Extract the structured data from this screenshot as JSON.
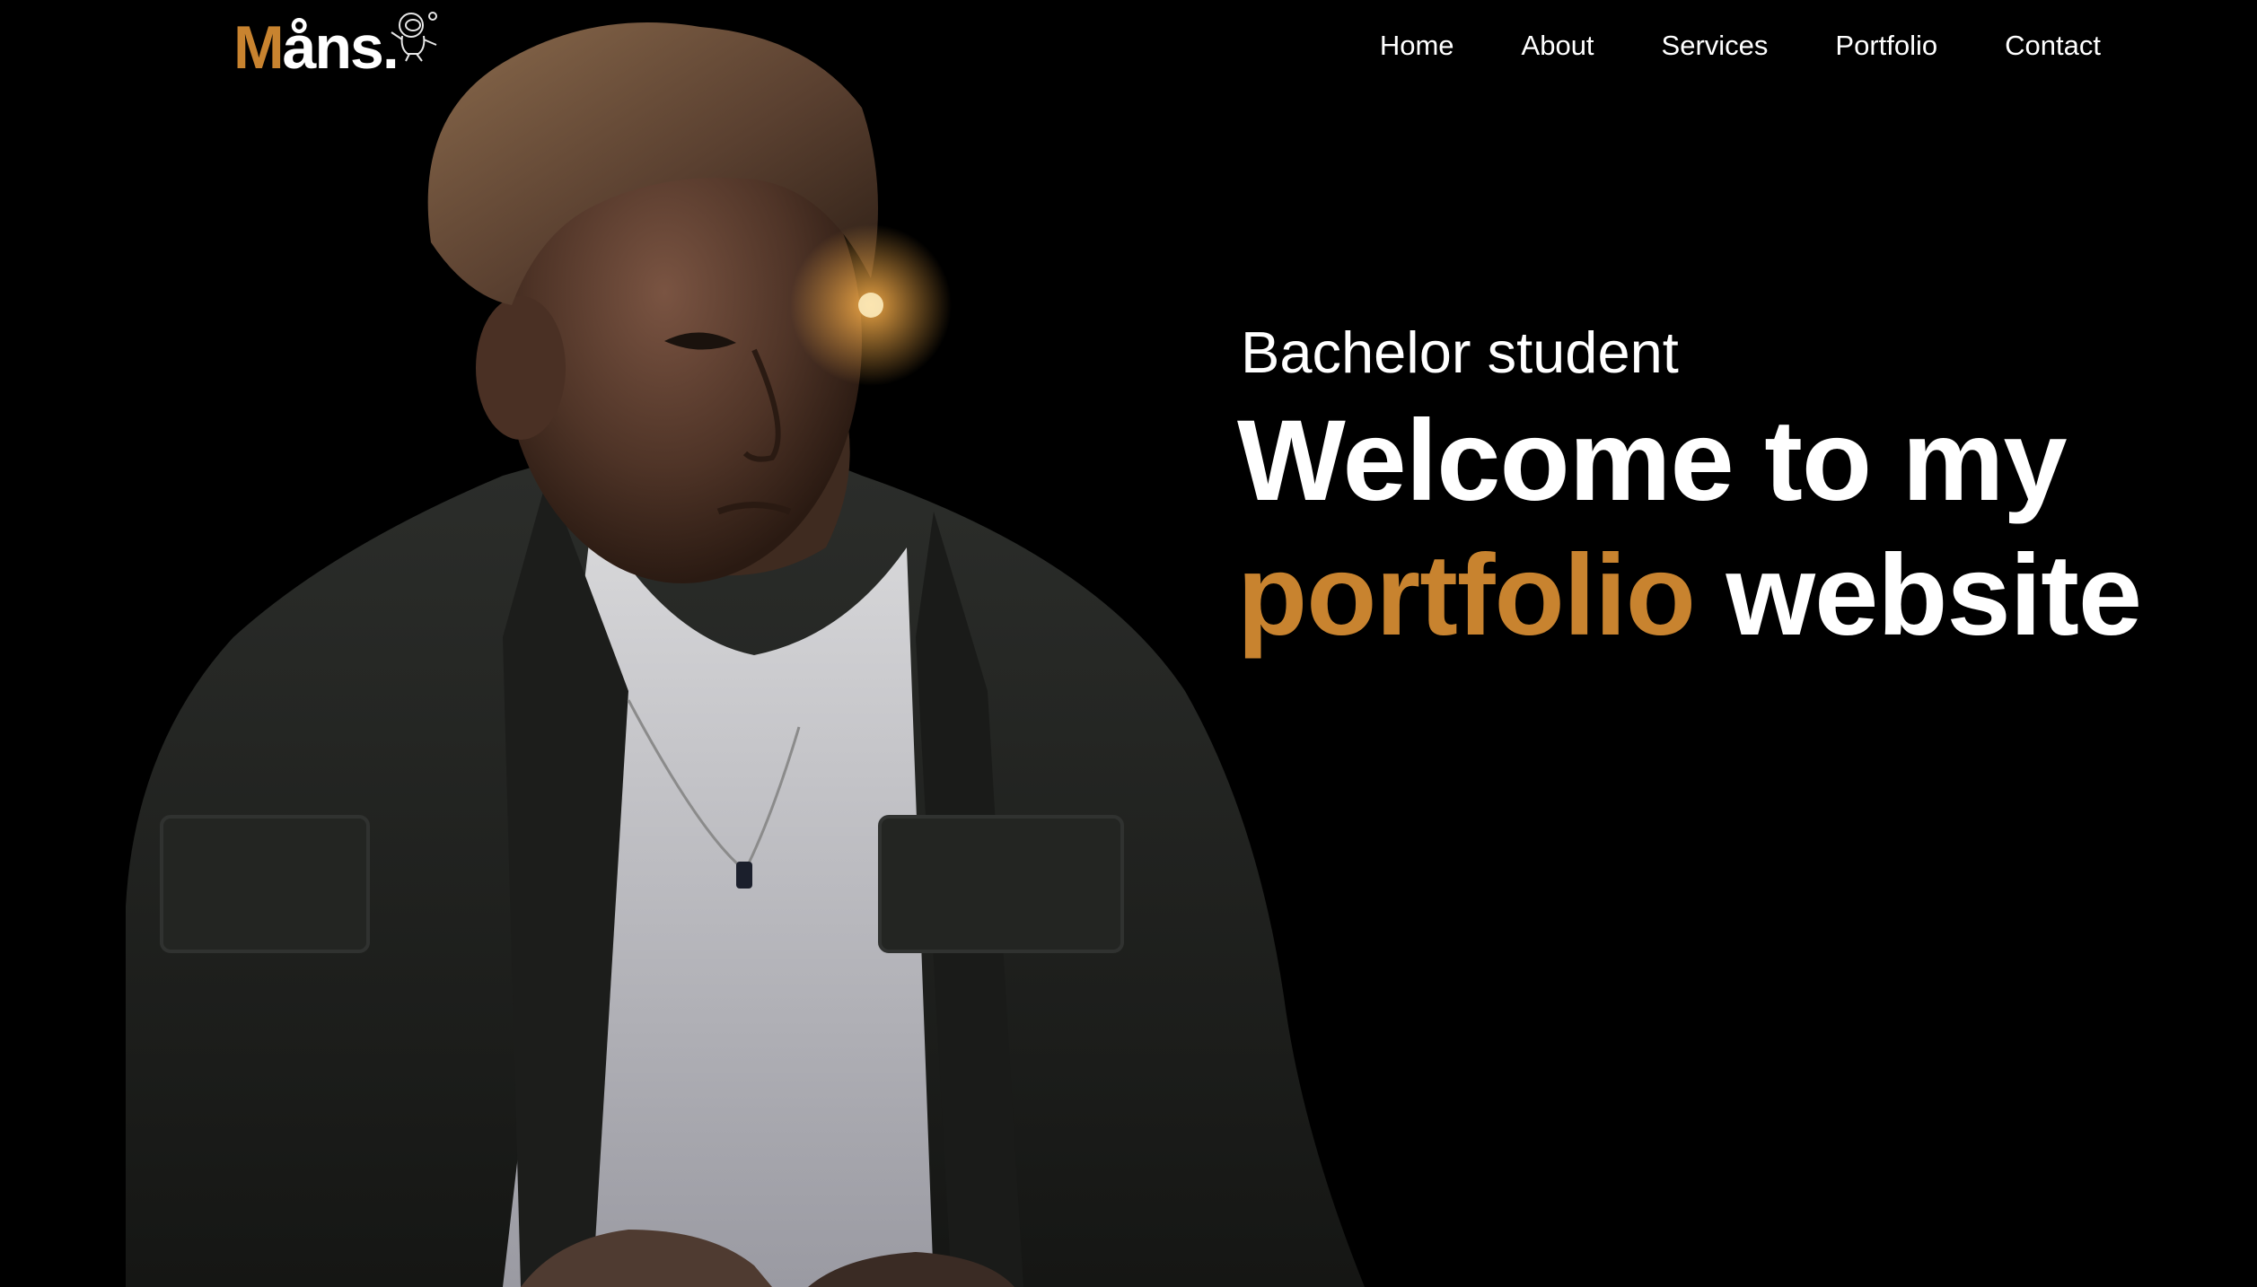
{
  "header": {
    "logo": {
      "accent_letter": "M",
      "rest": "åns."
    },
    "mascot_icon": "astronaut-icon",
    "nav": [
      {
        "label": "Home"
      },
      {
        "label": "About"
      },
      {
        "label": "Services"
      },
      {
        "label": "Portfolio"
      },
      {
        "label": "Contact"
      }
    ]
  },
  "hero": {
    "eyebrow": "Bachelor student",
    "title_line1": "Welcome to my",
    "title_highlight": "portfolio",
    "title_rest": "website"
  },
  "colors": {
    "background": "#000000",
    "text": "#ffffff",
    "accent": "#c8832f"
  }
}
